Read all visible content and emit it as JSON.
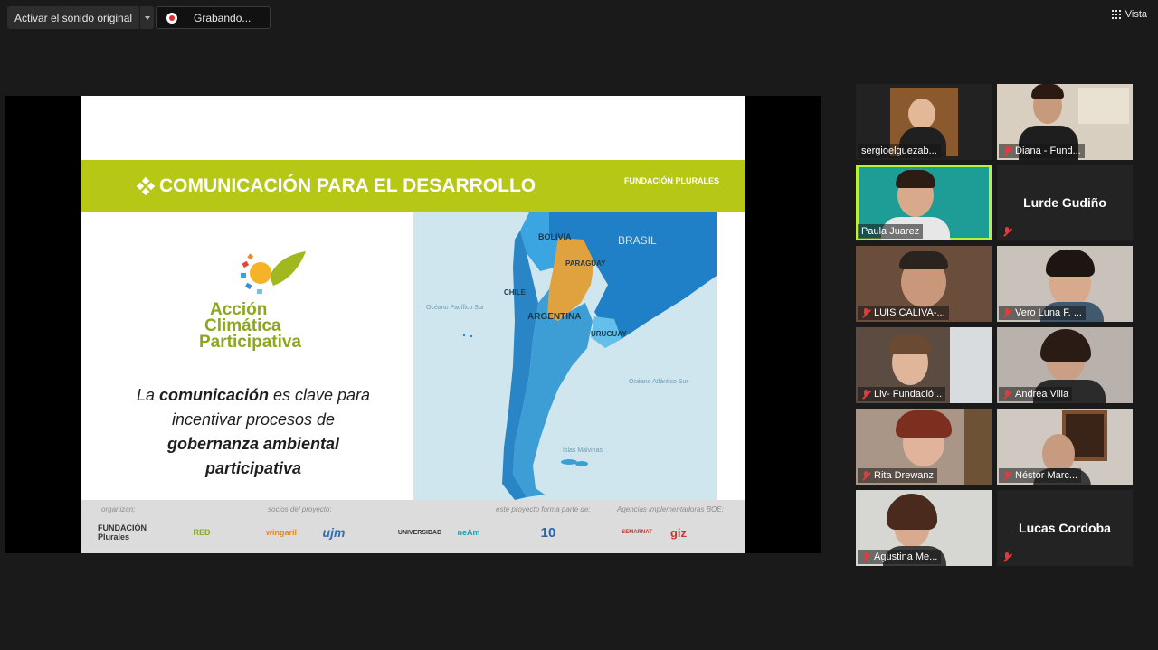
{
  "toolbar": {
    "audio_label": "Activar el sonido original",
    "recording_label": "Grabando...",
    "view_label": "Vista"
  },
  "slide": {
    "title": "COMUNICACIÓN PARA EL DESARROLLO",
    "org": "FUNDACIÓN PLURALES",
    "logo_lines": [
      "Acción",
      "Climática",
      "Participativa"
    ],
    "message": {
      "p1": "La ",
      "b1": "comunicación",
      "p2": " es clave para incentivar procesos de ",
      "b2": "gobernanza ambiental participativa"
    },
    "map_labels": {
      "bolivia": "BOLIVIA",
      "brasil": "BRASIL",
      "paraguay": "PARAGUAY",
      "chile": "CHILE",
      "argentina": "ARGENTINA",
      "uruguay": "URUGUAY",
      "pacific": "Océano Pacífico Sur",
      "atlantic": "Océano Atlántico Sur",
      "malvinas": "Islas Malvinas"
    },
    "footer": {
      "organizan": "organizan:",
      "socios": "socios del proyecto:",
      "forma_parte": "este proyecto forma parte de:",
      "agencias": "Agencias implementadoras BOE:",
      "sponsors": [
        "FUNDACIÓN Plurales",
        "RED",
        "wingaril",
        "ujm",
        "UNIVERSIDAD",
        "neAm",
        "10",
        "SEMARNAT",
        "giz"
      ]
    }
  },
  "participants": [
    {
      "name": "sergioelguezab...",
      "muted": false,
      "video": true
    },
    {
      "name": "Diana - Fund...",
      "muted": true,
      "video": true
    },
    {
      "name": "Paula Juarez",
      "muted": false,
      "video": true,
      "active": true
    },
    {
      "name": "Lurde Gudiño",
      "muted": true,
      "video": false
    },
    {
      "name": "LUIS CALIVA-...",
      "muted": true,
      "video": true
    },
    {
      "name": "Vero Luna F. ...",
      "muted": true,
      "video": true
    },
    {
      "name": "Liv- Fundació...",
      "muted": true,
      "video": true
    },
    {
      "name": "Andrea Villa",
      "muted": true,
      "video": true
    },
    {
      "name": "Rita Drewanz",
      "muted": true,
      "video": true
    },
    {
      "name": "Néstor Marc...",
      "muted": true,
      "video": true
    },
    {
      "name": "Agustina Me...",
      "muted": true,
      "video": true
    },
    {
      "name": "Lucas Cordoba",
      "muted": true,
      "video": false
    }
  ],
  "colors": {
    "banner": "#b7c716",
    "logo_green": "#8aa81c",
    "active_border": "#b9f03a",
    "muted_red": "#e23b3b"
  }
}
